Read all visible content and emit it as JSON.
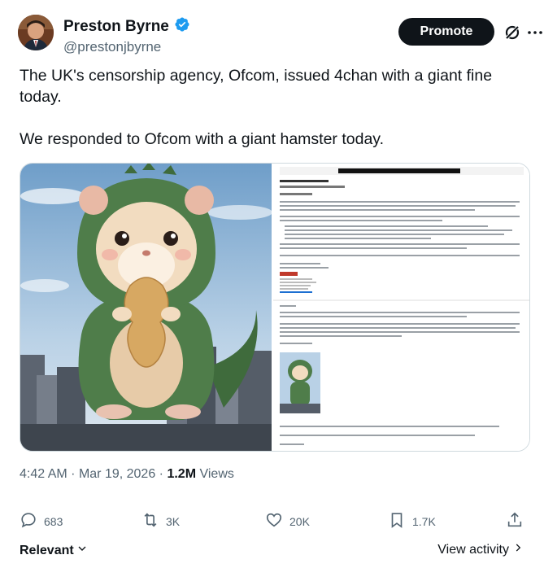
{
  "author": {
    "display_name": "Preston Byrne",
    "handle": "@prestonjbyrne",
    "verified": true
  },
  "header": {
    "promote_label": "Promote",
    "grok_icon": "grok-icon",
    "more_icon": "more-icon"
  },
  "tweet": {
    "paragraph_1": "The UK's censorship agency, Ofcom, issued 4chan with a giant fine today.",
    "paragraph_2": "We responded to Ofcom with a giant hamster today."
  },
  "media": {
    "left_description_icon": "hamster-image",
    "right_description_icon": "letter-screenshot"
  },
  "meta": {
    "time": "4:42 AM",
    "date": "Mar 19, 2026",
    "views_count": "1.2M",
    "views_label": "Views"
  },
  "actions": {
    "replies": "683",
    "reposts": "3K",
    "likes": "20K",
    "bookmarks": "1.7K"
  },
  "footer": {
    "relevant_label": "Relevant",
    "view_activity_label": "View activity"
  },
  "colors": {
    "verified_blue": "#1d9bf0",
    "text_primary": "#0f1419",
    "text_secondary": "#536471",
    "promote_bg": "#0f1419"
  }
}
